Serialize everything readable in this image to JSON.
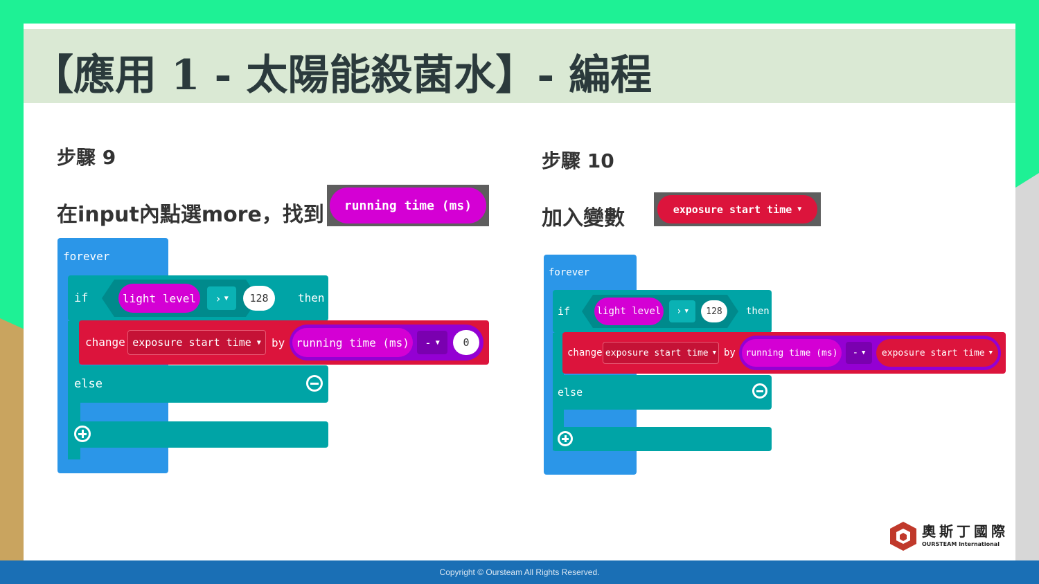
{
  "title": "【應用 1 - 太陽能殺菌水】- 編程",
  "left": {
    "step": "步驟 9",
    "instruction": "在input內點選more，找到",
    "chip_label": "running time (ms)",
    "code": {
      "forever": "forever",
      "if": "if",
      "condition_sensor": "light level",
      "operator": "›",
      "threshold": "128",
      "then": "then",
      "change": "change",
      "variable": "exposure start time",
      "by": "by",
      "value_reporter": "running time (ms)",
      "minus": "-",
      "operand": "0",
      "else": "else"
    }
  },
  "right": {
    "step": "步驟 10",
    "instruction": "加入變數",
    "chip_label": "exposure start time",
    "code": {
      "forever": "forever",
      "if": "if",
      "condition_sensor": "light level",
      "operator": "›",
      "threshold": "128",
      "then": "then",
      "change": "change",
      "variable": "exposure start time",
      "by": "by",
      "value_reporter": "running time (ms)",
      "minus": "-",
      "operand": "exposure start time",
      "else": "else"
    }
  },
  "logo": {
    "name": "奧斯丁國際",
    "subtitle": "OURSTEAM International"
  },
  "footer": "Copyright © Oursteam All Rights Reserved.",
  "colors": {
    "forever_blue": "#2b96e8",
    "logic_teal": "#00a4a6",
    "variable_red": "#dc143c",
    "input_magenta": "#d400d4",
    "math_purple": "#9400d3",
    "title_bar": "#dae9d4",
    "footer": "#1a6fb5"
  }
}
